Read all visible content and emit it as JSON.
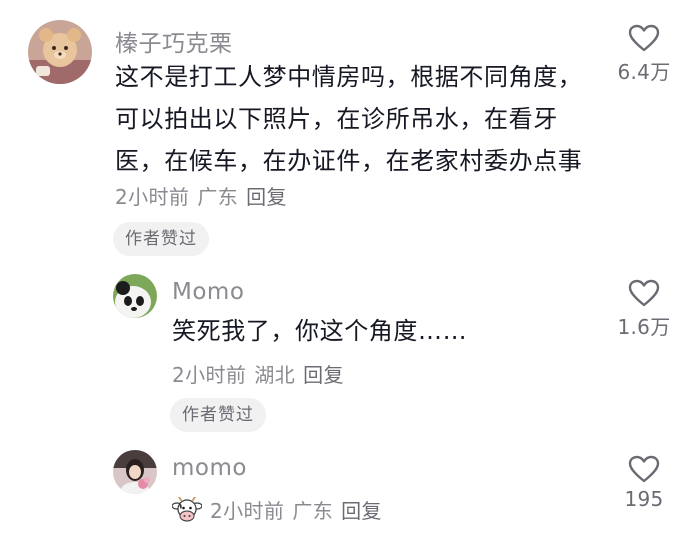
{
  "comments": [
    {
      "username": "榛子巧克栗",
      "lines": [
        "这不是打工人梦中情房吗，根据不同角度，",
        "可以拍出以下照片，在诊所吊水，在看牙",
        "医，在候车，在办证件，在老家村委办点事"
      ],
      "time": "2小时前",
      "location": "广东",
      "reply": "回复",
      "badge": "作者赞过",
      "likes": "6.4万"
    },
    {
      "username": "Momo",
      "lines": [
        "笑死我了，你这个角度……"
      ],
      "time": "2小时前",
      "location": "湖北",
      "reply": "回复",
      "badge": "作者赞过",
      "likes": "1.6万"
    },
    {
      "username": "momo",
      "time": "2小时前",
      "location": "广东",
      "reply": "回复",
      "likes": "195"
    }
  ],
  "icons": {
    "like": "heart-outline-icon",
    "sticker": "cow-face-icon"
  }
}
